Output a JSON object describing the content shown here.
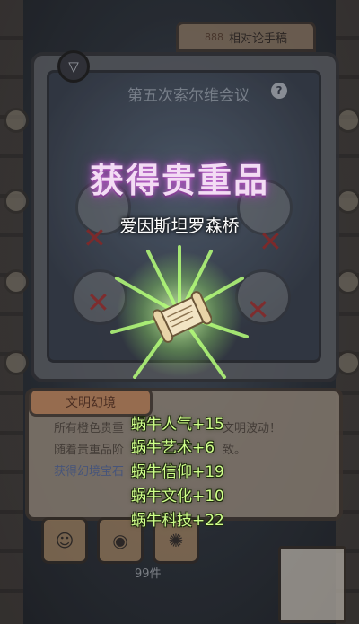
{
  "notebook": {
    "tab_label": "相对论手稿",
    "tab_badge": "888",
    "meeting_title": "第五次索尔维会议",
    "info_icon": "info-icon"
  },
  "reward": {
    "headline": "获得贵重品",
    "item_name": "爱因斯坦罗森桥",
    "item_icon": "scroll-icon",
    "stats": [
      "蜗牛人气+15",
      "蜗牛艺术+6",
      "蜗牛信仰+19",
      "蜗牛文化+10",
      "蜗牛科技+22"
    ]
  },
  "panel": {
    "tab_label": "文明幻境",
    "line1": "所有橙色贵重",
    "line1_tail": "文明波动！",
    "line2": "随着贵重品阶",
    "line2_tail": "致。",
    "line3": "获得幻境宝石"
  },
  "footer": {
    "count_label": "99件",
    "buttons": [
      "person-icon",
      "eye-icon",
      "gear-icon"
    ]
  },
  "colors": {
    "headline_glow": "#c06bd0",
    "stat_text": "#cfff8a",
    "ray_green": "#9cf26a"
  }
}
